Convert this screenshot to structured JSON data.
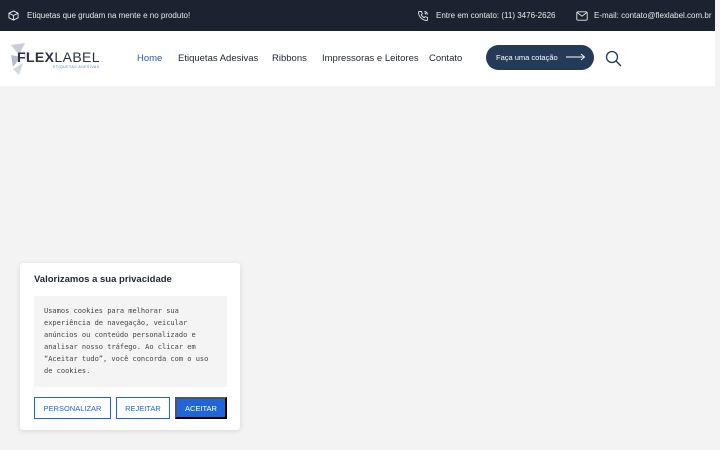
{
  "topbar": {
    "tagline": "Etiquetas que grudam na mente e no produto!",
    "phone": "Entre em contato: (11) 3476-2626",
    "email": "E-mail: contato@flexlabel.com.br"
  },
  "header": {
    "logo_word_bold": "FLEX",
    "logo_word_light": "LABEL",
    "logo_sub": "ETIQUETAS ADESIVAS",
    "nav": [
      "Home",
      "Etiquetas Adesivas",
      "Ribbons",
      "Impressoras e Leitores",
      "Contato"
    ],
    "cta_label": "Faça uma cotação"
  },
  "cookie": {
    "title": "Valorizamos a sua privacidade",
    "message": "Usamos cookies para melhorar sua experiência de navegação, veicular anúncios ou conteúdo personalizado e analisar nosso tráfego. Ao clicar em “Aceitar tudo”, você concorda com o uso de cookies.",
    "customize_label": "PERSONALIZAR",
    "reject_label": "REJEITAR",
    "accept_label": "ACEITAR"
  },
  "colors": {
    "topbar_bg": "#1c2330",
    "cta_bg": "#243a57",
    "accent": "#2166d8",
    "nav_active": "#2c5aa8"
  }
}
